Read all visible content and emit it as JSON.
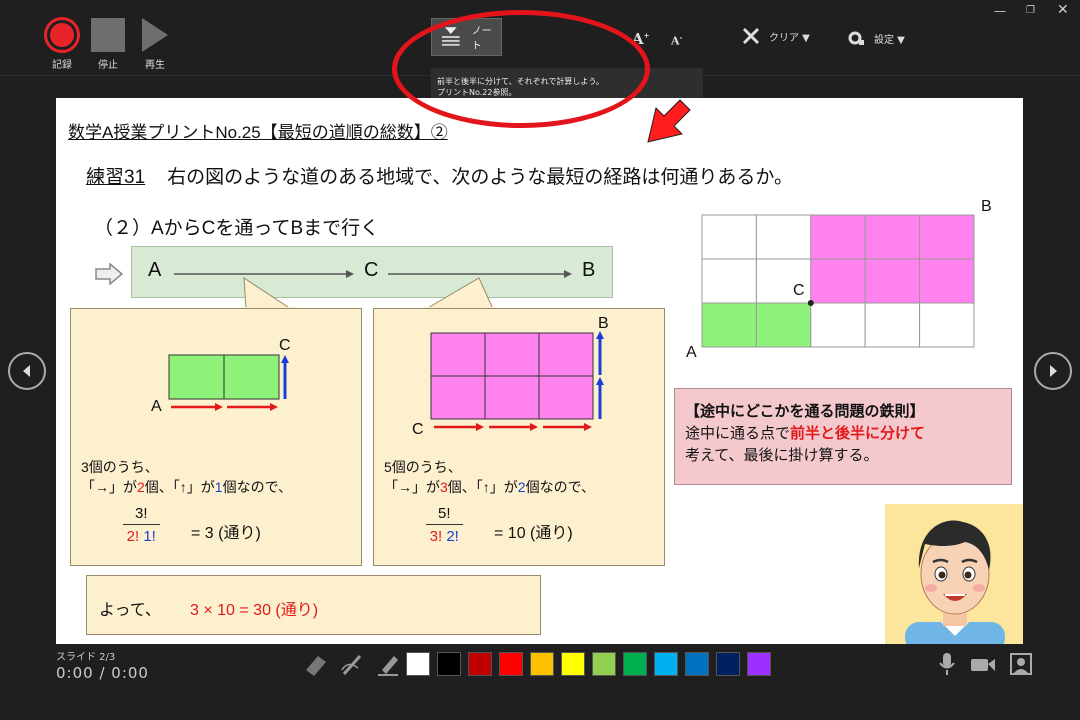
{
  "toolbar": {
    "record_label": "記録",
    "stop_label": "停止",
    "play_label": "再生",
    "note_label": "ノート",
    "font_increase": "A",
    "font_decrease": "A",
    "clear_label": "クリア ▼",
    "settings_label": "設定 ▼"
  },
  "note": {
    "line1": "前半と後半に分けて、それぞれで計算しよう。",
    "line2": "プリントNo.22参照。"
  },
  "slide": {
    "title": "数学A授業プリントNo.25【最短の道順の総数】②",
    "exercise_label": "練習31",
    "exercise_text": "右の図のような道のある地域で、次のような最短の経路は何通りあるか。",
    "subquestion": "（２）AからCを通ってBまで行く",
    "path": {
      "a": "A",
      "c": "C",
      "b": "B"
    },
    "left_calc": {
      "grid_a": "A",
      "grid_c": "C",
      "line1": "3個のうち、",
      "line2_pre": "「→」が",
      "line2_n1": "2",
      "line2_mid": "個、「↑」が",
      "line2_n2": "1",
      "line2_post": "個なので、",
      "frac_num": "3!",
      "frac_den_1": "2!",
      "frac_den_2": "1!",
      "result": "= 3 (通り)"
    },
    "right_calc": {
      "grid_c": "C",
      "grid_b": "B",
      "line1": "5個のうち、",
      "line2_pre": "「→」が",
      "line2_n1": "3",
      "line2_mid": "個、「↑」が",
      "line2_n2": "2",
      "line2_post": "個なので、",
      "frac_num": "5!",
      "frac_den_1": "3!",
      "frac_den_2": "2!",
      "result": "= 10 (通り)"
    },
    "conclusion_label": "よって、",
    "conclusion_value": "3 × 10 = 30 (通り)",
    "map": {
      "a": "A",
      "b": "B",
      "c": "C"
    },
    "rule": {
      "title": "【途中にどこかを通る問題の鉄則】",
      "text_pre": "途中に通る点で",
      "text_hl": "前半と後半に分けて",
      "text_post": "考えて、最後に掛け算する。"
    }
  },
  "status": {
    "slide_counter": "スライド 2/3",
    "timer": "0:00 / 0:00"
  },
  "pen_colors": [
    "#ffffff",
    "#000000",
    "#c00000",
    "#ff0000",
    "#ffc000",
    "#ffff00",
    "#92d050",
    "#00b050",
    "#00b0f0",
    "#0070c0",
    "#002060",
    "#9b30ff"
  ],
  "colors": {
    "record_red": "#e8242a",
    "magenta_cell": "#ff82ee",
    "green_cell": "#8ef27a",
    "arrow_red": "#e3191a",
    "arrow_blue": "#1a3fd8"
  }
}
